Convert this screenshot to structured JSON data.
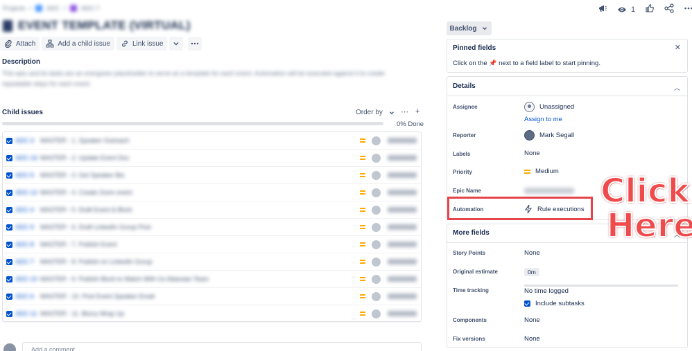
{
  "breadcrumb": {
    "items": [
      "Projects",
      "ADC",
      "ADC-7"
    ]
  },
  "issue": {
    "title": "EVENT TEMPLATE (VIRTUAL)",
    "description": "This epic and its tasks are an evergreen placeholder to serve as a template for each event. Automation will be executed against it to create repeatable steps for each event."
  },
  "toolbar": {
    "attach": "Attach",
    "add_child": "Add a child issue",
    "link_issue": "Link issue"
  },
  "labels": {
    "description": "Description",
    "child_issues": "Child issues",
    "order_by": "Order by",
    "done_pct": "0% Done",
    "comment_placeholder": "Add a comment..."
  },
  "child_progress": {
    "done_fraction": 0.0
  },
  "child_issues": [
    {
      "key": "ADC-3",
      "summary": "MASTER - 1. Speaker Outreach",
      "assignee": "Unassigned"
    },
    {
      "key": "ADC-16",
      "summary": "MASTER - 2. Update Event Doc",
      "assignee": "Unassigned"
    },
    {
      "key": "ADC-5",
      "summary": "MASTER - 3. Get Speaker Bio",
      "assignee": "Unassigned"
    },
    {
      "key": "ADC-12",
      "summary": "MASTER - 4. Create Zoom event",
      "assignee": "Unassigned"
    },
    {
      "key": "ADC-4",
      "summary": "MASTER - 5. Draft Event & Blurb",
      "assignee": "Unassigned"
    },
    {
      "key": "ADC-9",
      "summary": "MASTER - 6. Draft LinkedIn Group Post",
      "assignee": "Unassigned"
    },
    {
      "key": "ADC-8",
      "summary": "MASTER - 7. Publish Event",
      "assignee": "Unassigned"
    },
    {
      "key": "ADC-7",
      "summary": "MASTER - 8. Publish on LinkedIn Group",
      "assignee": "Unassigned"
    },
    {
      "key": "ADC-10",
      "summary": "MASTER - 9. Publish Blurb to Watch With Us Atlassian Team",
      "assignee": "Unassigned"
    },
    {
      "key": "ADC-6",
      "summary": "MASTER - 10. Post Event Speaker Email",
      "assignee": "Unassigned"
    },
    {
      "key": "ADC-11",
      "summary": "MASTER - 11. Blurry Wrap Up",
      "assignee": "Unassigned"
    }
  ],
  "header": {
    "watch_count": "1"
  },
  "status_button": "Backlog",
  "pinned": {
    "title": "Pinned fields",
    "hint_prefix": "Click on the",
    "hint_suffix": "next to a field label to start pinning."
  },
  "details": {
    "title": "Details",
    "assignee_label": "Assignee",
    "assignee_value": "Unassigned",
    "assign_to_me": "Assign to me",
    "reporter_label": "Reporter",
    "reporter_value": "Mark Segall",
    "labels_label": "Labels",
    "labels_value": "None",
    "priority_label": "Priority",
    "priority_value": "Medium",
    "epic_label": "Epic Name",
    "automation_label": "Automation",
    "automation_value": "Rule executions"
  },
  "more_fields": {
    "title": "More fields",
    "story_points_label": "Story Points",
    "story_points_value": "None",
    "original_estimate_label": "Original estimate",
    "original_estimate_value": "0m",
    "time_tracking_label": "Time tracking",
    "time_tracking_value": "No time logged",
    "include_subtasks": "Include subtasks",
    "components_label": "Components",
    "components_value": "None",
    "fix_versions_label": "Fix versions",
    "fix_versions_value": "None"
  },
  "callout": {
    "line1": "Click",
    "line2": "Here"
  },
  "colors": {
    "accent": "#0052cc",
    "highlight": "#e5454a",
    "priority": "#ffab00"
  }
}
